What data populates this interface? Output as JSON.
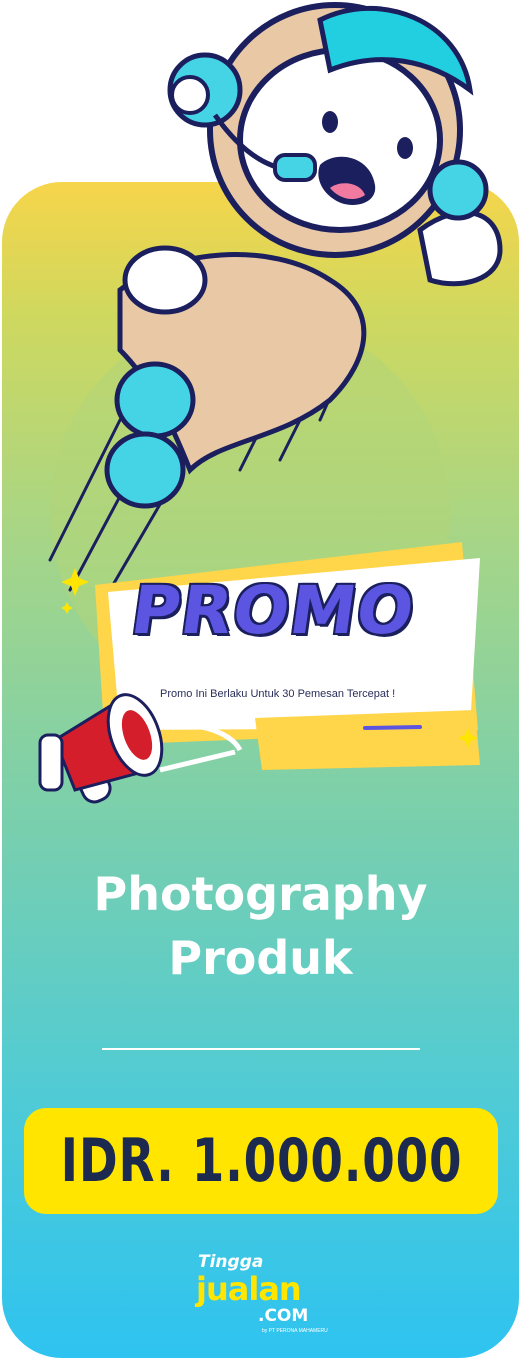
{
  "promo": {
    "title": "PROMO",
    "subtitle": "Promo Ini Berlaku Untuk 30 Pemesan Tercepat !"
  },
  "product": {
    "title_line1": "Photography",
    "title_line2": "Produk"
  },
  "price": {
    "label": "IDR. 1.000.000"
  },
  "logo": {
    "line1": "Tingga",
    "line2": "jualan",
    "line3": ".COM",
    "tagline": "by PT PERONA MAHAMERU"
  },
  "colors": {
    "background_top": "#f6d54a",
    "background_bottom": "#2ec3f0",
    "price_box": "#ffe500",
    "price_text": "#1b2a4e",
    "promo_title": "#5b55e2",
    "outline": "#1b1f5e"
  },
  "icons": [
    "astronaut-illustration",
    "megaphone-icon",
    "sparkle-icon"
  ]
}
